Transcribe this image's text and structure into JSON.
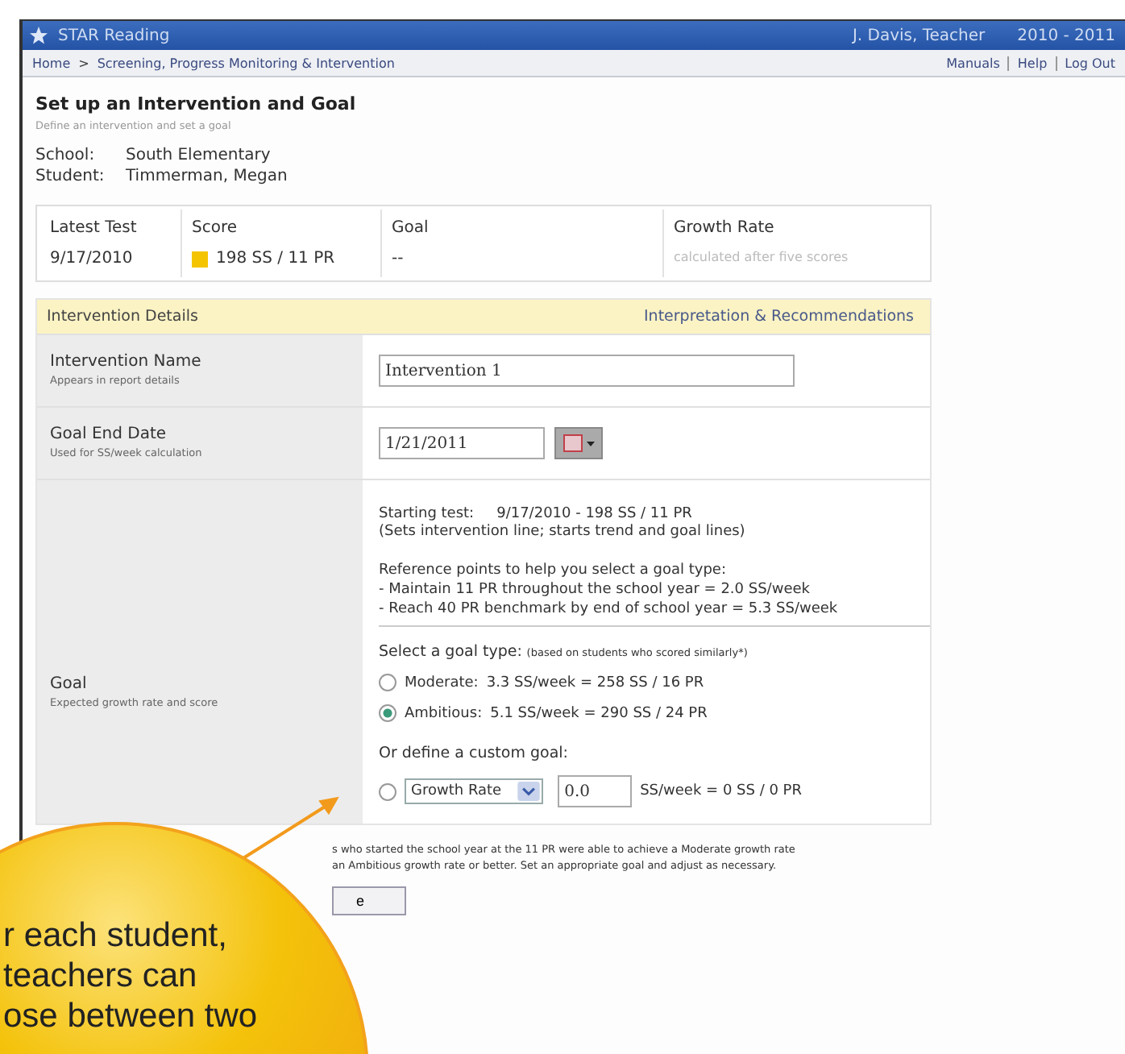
{
  "header": {
    "app_name": "STAR Reading",
    "user": "J. Davis, Teacher",
    "year": "2010 - 2011"
  },
  "breadcrumb": {
    "items": [
      "Home",
      "Screening, Progress Monitoring & Intervention"
    ],
    "separator": ">",
    "links": [
      "Manuals",
      "Help",
      "Log Out"
    ]
  },
  "page": {
    "title": "Set up an Intervention and Goal",
    "subtitle": "Define an intervention and set a goal",
    "school_label": "School:",
    "school": "South Elementary",
    "student_label": "Student:",
    "student": "Timmerman, Megan"
  },
  "summary": {
    "columns": [
      {
        "heading": "Latest Test",
        "value": "9/17/2010",
        "kind": "plain"
      },
      {
        "heading": "Score",
        "value": "198 SS / 11 PR",
        "kind": "swatch",
        "color": "#f5c400"
      },
      {
        "heading": "Goal",
        "value": "--",
        "kind": "plain"
      },
      {
        "heading": "Growth Rate",
        "value": "calculated after five scores",
        "kind": "muted"
      }
    ]
  },
  "details": {
    "title": "Intervention Details",
    "link": "Interpretation & Recommendations",
    "name_row": {
      "label": "Intervention Name",
      "hint": "Appears in report details",
      "value": "Intervention 1"
    },
    "date_row": {
      "label": "Goal End Date",
      "hint": "Used for SS/week calculation",
      "value": "1/21/2011"
    },
    "goal_row": {
      "label": "Goal",
      "hint": "Expected growth rate and score",
      "starting_label": "Starting test:",
      "starting_value": "9/17/2010 - 198 SS / 11 PR",
      "starting_note": "(Sets intervention line; starts trend and goal lines)",
      "reference_title": "Reference points to help you select a goal type:",
      "reference_lines": [
        "- Maintain 11 PR throughout the school year = 2.0 SS/week",
        "- Reach 40 PR benchmark by end of school year = 5.3 SS/week"
      ],
      "select_title": "Select a goal type:",
      "select_note": "(based on students who scored similarly*)",
      "options": [
        {
          "label": "Moderate:",
          "value": "3.3 SS/week = 258 SS / 16 PR",
          "selected": false
        },
        {
          "label": "Ambitious:",
          "value": "5.1 SS/week = 290 SS / 24 PR",
          "selected": true
        }
      ],
      "custom_title": "Or define a custom goal:",
      "custom_selected": false,
      "custom_type": "Growth Rate",
      "custom_value": "0.0",
      "custom_result": "SS/week = 0 SS / 0 PR"
    }
  },
  "footnote": [
    "s who started the school year at the 11 PR were able to achieve a Moderate growth rate",
    "an Ambitious growth rate or better. Set an appropriate goal and adjust as necessary."
  ],
  "button_visible": "e",
  "callout": {
    "lines": [
      "r each student,",
      "teachers can",
      "ose between two"
    ]
  }
}
